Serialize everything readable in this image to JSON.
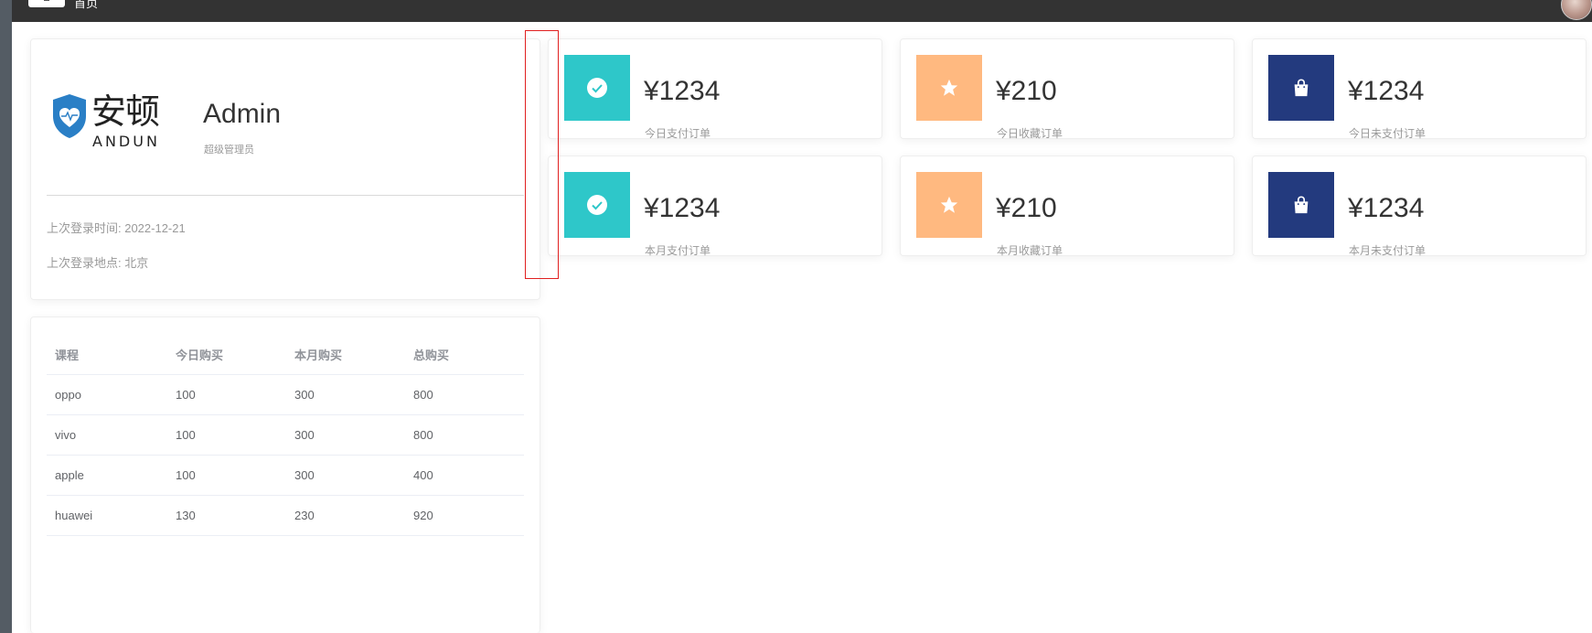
{
  "topbar": {
    "breadcrumb": "首页"
  },
  "user": {
    "logo_cn": "安顿",
    "logo_en": "ANDUN",
    "name": "Admin",
    "role": "超级管理员",
    "last_login_time": "上次登录时间: 2022-12-21",
    "last_login_place": "上次登录地点: 北京"
  },
  "table": {
    "headers": [
      "课程",
      "今日购买",
      "本月购买",
      "总购买"
    ],
    "rows": [
      [
        "oppo",
        "100",
        "300",
        "800"
      ],
      [
        "vivo",
        "100",
        "300",
        "800"
      ],
      [
        "apple",
        "100",
        "300",
        "400"
      ],
      [
        "huawei",
        "130",
        "230",
        "920"
      ]
    ]
  },
  "stats": [
    {
      "value": "¥1234",
      "label": "今日支付订单",
      "icon": "check-circle-icon",
      "color": "#2ec7c9"
    },
    {
      "value": "¥210",
      "label": "今日收藏订单",
      "icon": "star-icon",
      "color": "#ffb980"
    },
    {
      "value": "¥1234",
      "label": "今日未支付订单",
      "icon": "shopping-bag-icon",
      "color": "#233a7e"
    },
    {
      "value": "¥1234",
      "label": "本月支付订单",
      "icon": "check-circle-icon",
      "color": "#2ec7c9"
    },
    {
      "value": "¥210",
      "label": "本月收藏订单",
      "icon": "star-icon",
      "color": "#ffb980"
    },
    {
      "value": "¥1234",
      "label": "本月未支付订单",
      "icon": "shopping-bag-icon",
      "color": "#233a7e"
    }
  ]
}
